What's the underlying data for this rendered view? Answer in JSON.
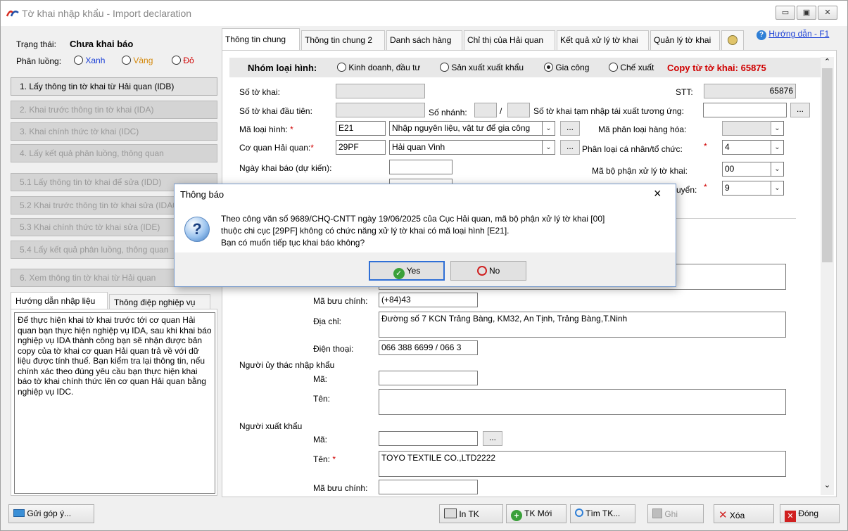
{
  "window": {
    "title": "Tờ khai nhập khẩu - Import declaration"
  },
  "status": {
    "label": "Trạng thái:",
    "value": "Chưa khai báo",
    "channel_label": "Phân luồng:",
    "channels": [
      "Xanh",
      "Vàng",
      "Đỏ"
    ],
    "channel_colors": [
      "#1a3fd6",
      "#d4880a",
      "#d00000"
    ]
  },
  "steps": [
    "1. Lấy thông tin tờ khai từ Hải quan (IDB)",
    "2. Khai trước thông tin tờ khai (IDA)",
    "3. Khai chính thức tờ khai (IDC)",
    "4. Lấy kết quả phân luồng, thông quan",
    "5.1 Lấy thông tin tờ khai để sửa (IDD)",
    "5.2 Khai trước thông tin tờ khai sửa (IDA01)",
    "5.3 Khai chính thức tờ khai sửa (IDE)",
    "5.4 Lấy kết quả phân luồng, thông quan",
    "6. Xem thông tin tờ khai từ Hải quan"
  ],
  "guide_tabs": [
    "Hướng dẫn nhập liệu",
    "Thông điệp nghiệp vụ"
  ],
  "guide_text": "Để thực hiện khai tờ khai trước tới cơ quan Hải quan bạn thực hiện nghiệp vụ IDA, sau khi khai báo nghiệp vụ IDA thành công bạn sẽ nhận được bản copy của tờ khai cơ quan Hải quan trả về với dữ liệu được tính thuế. Bạn kiểm tra lại thông tin, nếu chính xác theo đúng yêu cầu bạn thực hiện khai báo tờ khai chính thức lên cơ quan Hải quan bằng nghiệp vụ IDC.",
  "tabs": [
    "Thông tin chung",
    "Thông tin chung 2",
    "Danh sách hàng",
    "Chỉ thị của Hải quan",
    "Kết quả xử lý tờ khai",
    "Quản lý tờ khai"
  ],
  "help_link": "Hướng dẫn - F1",
  "group": {
    "label": "Nhóm loại hình:",
    "options": [
      "Kinh doanh, đầu tư",
      "Sản xuất xuất khẩu",
      "Gia công",
      "Chế xuất"
    ],
    "copy_text": "Copy từ tờ khai: 65875"
  },
  "form": {
    "so_to_khai": "Số tờ khai:",
    "stt_label": "STT:",
    "stt_value": "65876",
    "so_to_khai_dau_tien": "Số tờ khai đầu tiên:",
    "so_nhanh": "Số nhánh:",
    "slash": "/",
    "so_tk_tam_nhap": "Số tờ khai tạm nhập tái xuất tương ứng:",
    "ma_loai_hinh": "Mã loại hình:",
    "ma_loai_hinh_code": "E21",
    "ma_loai_hinh_name": "Nhập nguyên liệu, vật tư để gia công",
    "ma_phan_loai": "Mã phân loại hàng hóa:",
    "co_quan_hq": "Cơ quan Hải quan:",
    "co_quan_code": "29PF",
    "co_quan_name": "Hải quan Vinh",
    "phan_loai_ca_nhan": "Phân loại cá nhân/tổ chức:",
    "phan_loai_value": "4",
    "ngay_khai_bao": "Ngày khai báo (dự kiến):",
    "ma_bo_phan": "Mã bộ phận xử lý tờ khai:",
    "ma_bo_phan_value": "00",
    "van_chuyen_label": "uyển:",
    "van_chuyen_value": "9",
    "ma_buu_chinh": "Mã bưu chính:",
    "ma_buu_chinh_value": "(+84)43",
    "dia_chi": "Địa chỉ:",
    "dia_chi_value": "Đường số 7 KCN Trảng Bàng, KM32,  An Tịnh, Trảng Bàng,T.Ninh",
    "dien_thoai": "Điện thoại:",
    "dien_thoai_value": "066 388 6699 / 066 3",
    "nguoi_uy_thac": "Người ủy thác nhập khẩu",
    "ma": "Mã:",
    "ten": "Tên:",
    "nguoi_xuat_khau": "Người xuất khẩu",
    "ten_xk_value": "TOYO TEXTILE CO.,LTD2222",
    "ma_buu_chinh_xk": "Mã bưu chính:",
    "dots": "...",
    "req": "*"
  },
  "bottom": {
    "feedback": "Gửi góp ý...",
    "print": "In TK",
    "new": "TK Mới",
    "find": "Tìm TK...",
    "save": "Ghi",
    "delete": "Xóa",
    "close": "Đóng"
  },
  "dialog": {
    "title": "Thông báo",
    "line1": "Theo công văn số 9689/CHQ-CNTT ngày 19/06/2025 của Cục Hải quan, mã bộ phận xử lý tờ khai [00]",
    "line2": "thuộc chi cục [29PF] không có chức năng xử lý tờ khai có mã loại hình [E21].",
    "line3": "Bạn có muốn tiếp tục khai báo không?",
    "yes": "Yes",
    "no": "No"
  }
}
